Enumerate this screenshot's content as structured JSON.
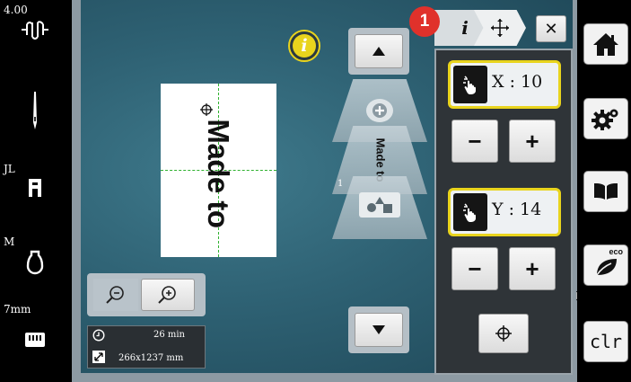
{
  "left_sidebar": {
    "tension_value": "4.00",
    "stitch_type": "JL",
    "presser_foot": "M",
    "stitch_length": "7mm"
  },
  "canvas": {
    "design_text": "Made to"
  },
  "info": {
    "time": "26 min",
    "size": "266x1237 mm"
  },
  "layers": {
    "preview_text": "Made to",
    "layer_number": "1"
  },
  "tabs": {
    "badge_number": "1",
    "info_tab": "i",
    "move_tab": "✛",
    "close": "✕"
  },
  "position_panel": {
    "x_label": "X : 10",
    "y_label": "Y : 14",
    "minus": "−",
    "plus": "+"
  },
  "right_sidebar": {
    "eco_label": "eco",
    "clr_label": "clr"
  },
  "colors": {
    "accent_yellow": "#e9d41d",
    "badge_red": "#e0312b",
    "background_teal": "#2e6173"
  },
  "icons": {
    "tension": "thread-tension-icon",
    "needle": "needle-icon",
    "stitch": "stitch-plate-icon",
    "foot": "presser-foot-icon",
    "feed": "feed-dog-icon",
    "home": "home-icon",
    "settings": "gear-icon",
    "tutorial": "book-icon",
    "eco": "eco-leaf-icon"
  }
}
